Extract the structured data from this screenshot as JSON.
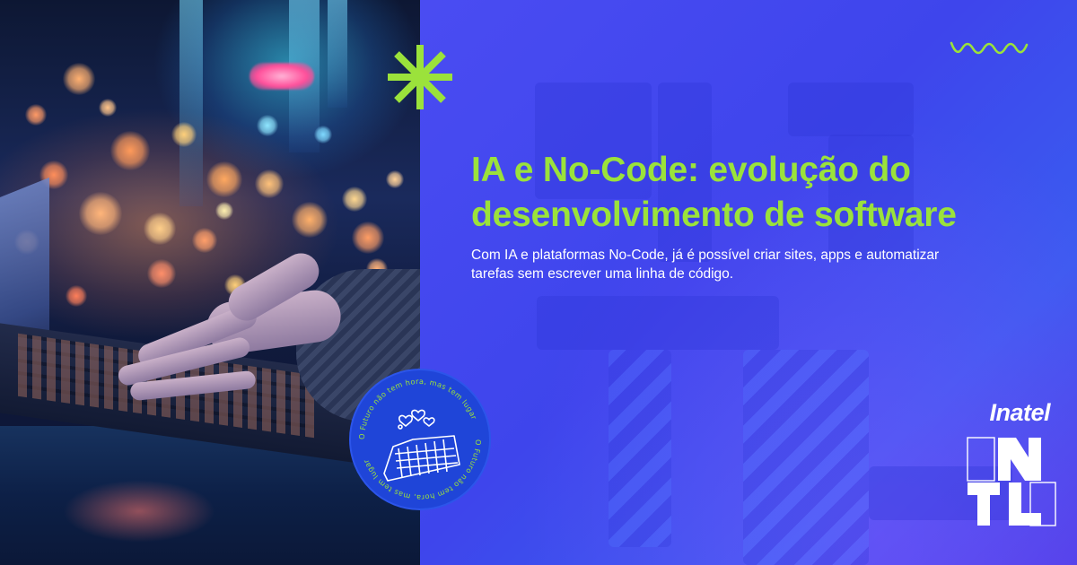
{
  "headline": {
    "title": "IA e No-Code: evolução do desenvolvimento de software",
    "subtitle": "Com IA e plataformas No-Code, já é possível criar sites, apps e automatizar tarefas sem escrever uma linha de código."
  },
  "badge": {
    "text": "O Futuro não tem hora, mas tem lugar"
  },
  "brand": {
    "name": "Inatel",
    "mark_letters": [
      "N",
      "T",
      "L"
    ]
  },
  "colors": {
    "accent_green": "#9be23b",
    "background_blue": "#3e45ec",
    "badge_blue": "#1f45d8",
    "text_white": "#ffffff"
  },
  "icons": {
    "decor_top": "asterisk-icon",
    "decor_wave": "wave-icon",
    "badge_art": "building-hearts-icon"
  }
}
